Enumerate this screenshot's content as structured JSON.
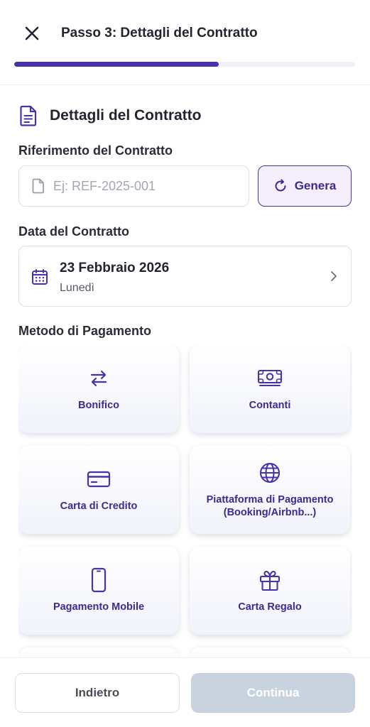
{
  "header": {
    "title": "Passo 3: Dettagli del Contratto",
    "progress": 0.6
  },
  "section": {
    "title": "Dettagli del Contratto"
  },
  "reference": {
    "label": "Riferimento del Contratto",
    "placeholder": "Ej: REF-2025-001",
    "value": "",
    "generate_label": "Genera"
  },
  "date": {
    "label": "Data del Contratto",
    "value": "23 Febbraio 2026",
    "weekday": "Lunedì"
  },
  "payment": {
    "label": "Metodo di Pagamento",
    "methods": [
      {
        "label": "Bonifico",
        "icon": "transfer-arrows-icon"
      },
      {
        "label": "Contanti",
        "icon": "cash-icon"
      },
      {
        "label": "Carta di Credito",
        "icon": "credit-card-icon"
      },
      {
        "label": "Piattaforma di Pagamento\n(Booking/Airbnb...)",
        "icon": "globe-icon"
      },
      {
        "label": "Pagamento Mobile",
        "icon": "mobile-phone-icon"
      },
      {
        "label": "Carta Regalo",
        "icon": "gift-icon"
      }
    ]
  },
  "footer": {
    "back_label": "Indietro",
    "continue_label": "Continua"
  },
  "colors": {
    "accent": "#4b31a8",
    "accent_text": "#3d2a91",
    "disabled_button": "#c9d2df"
  }
}
